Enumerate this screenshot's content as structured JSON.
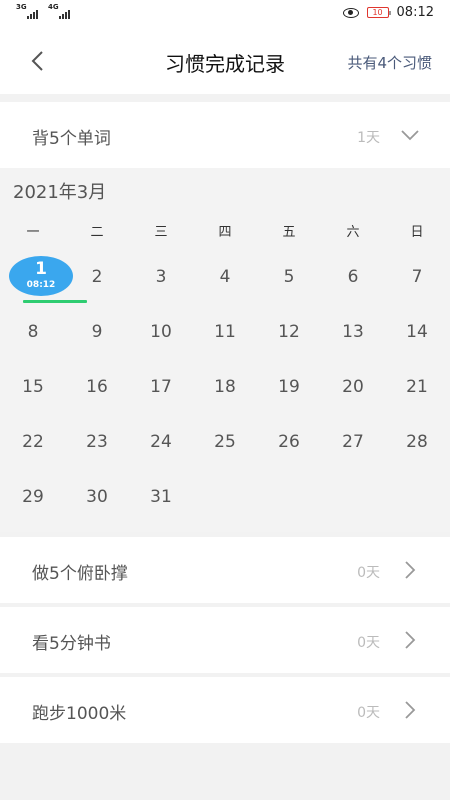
{
  "status_bar": {
    "sig1": "3G",
    "sig2": "4G",
    "battery": "10",
    "time": "08:12"
  },
  "header": {
    "title": "习惯完成记录",
    "right_text": "共有4个习惯"
  },
  "expanded_habit": {
    "name": "背5个单词",
    "days": "1天"
  },
  "calendar": {
    "month_label": "2021年3月",
    "weekdays": [
      "一",
      "二",
      "三",
      "四",
      "五",
      "六",
      "日"
    ],
    "weeks": [
      [
        "1",
        "2",
        "3",
        "4",
        "5",
        "6",
        "7"
      ],
      [
        "8",
        "9",
        "10",
        "11",
        "12",
        "13",
        "14"
      ],
      [
        "15",
        "16",
        "17",
        "18",
        "19",
        "20",
        "21"
      ],
      [
        "22",
        "23",
        "24",
        "25",
        "26",
        "27",
        "28"
      ],
      [
        "29",
        "30",
        "31",
        "",
        "",
        "",
        ""
      ]
    ],
    "selected_day": "1",
    "selected_time": "08:12",
    "accent_color": "#3aa7ee",
    "marker_color": "#2ecc71"
  },
  "habits": [
    {
      "name": "做5个俯卧撑",
      "days": "0天"
    },
    {
      "name": "看5分钟书",
      "days": "0天"
    },
    {
      "name": "跑步1000米",
      "days": "0天"
    }
  ]
}
